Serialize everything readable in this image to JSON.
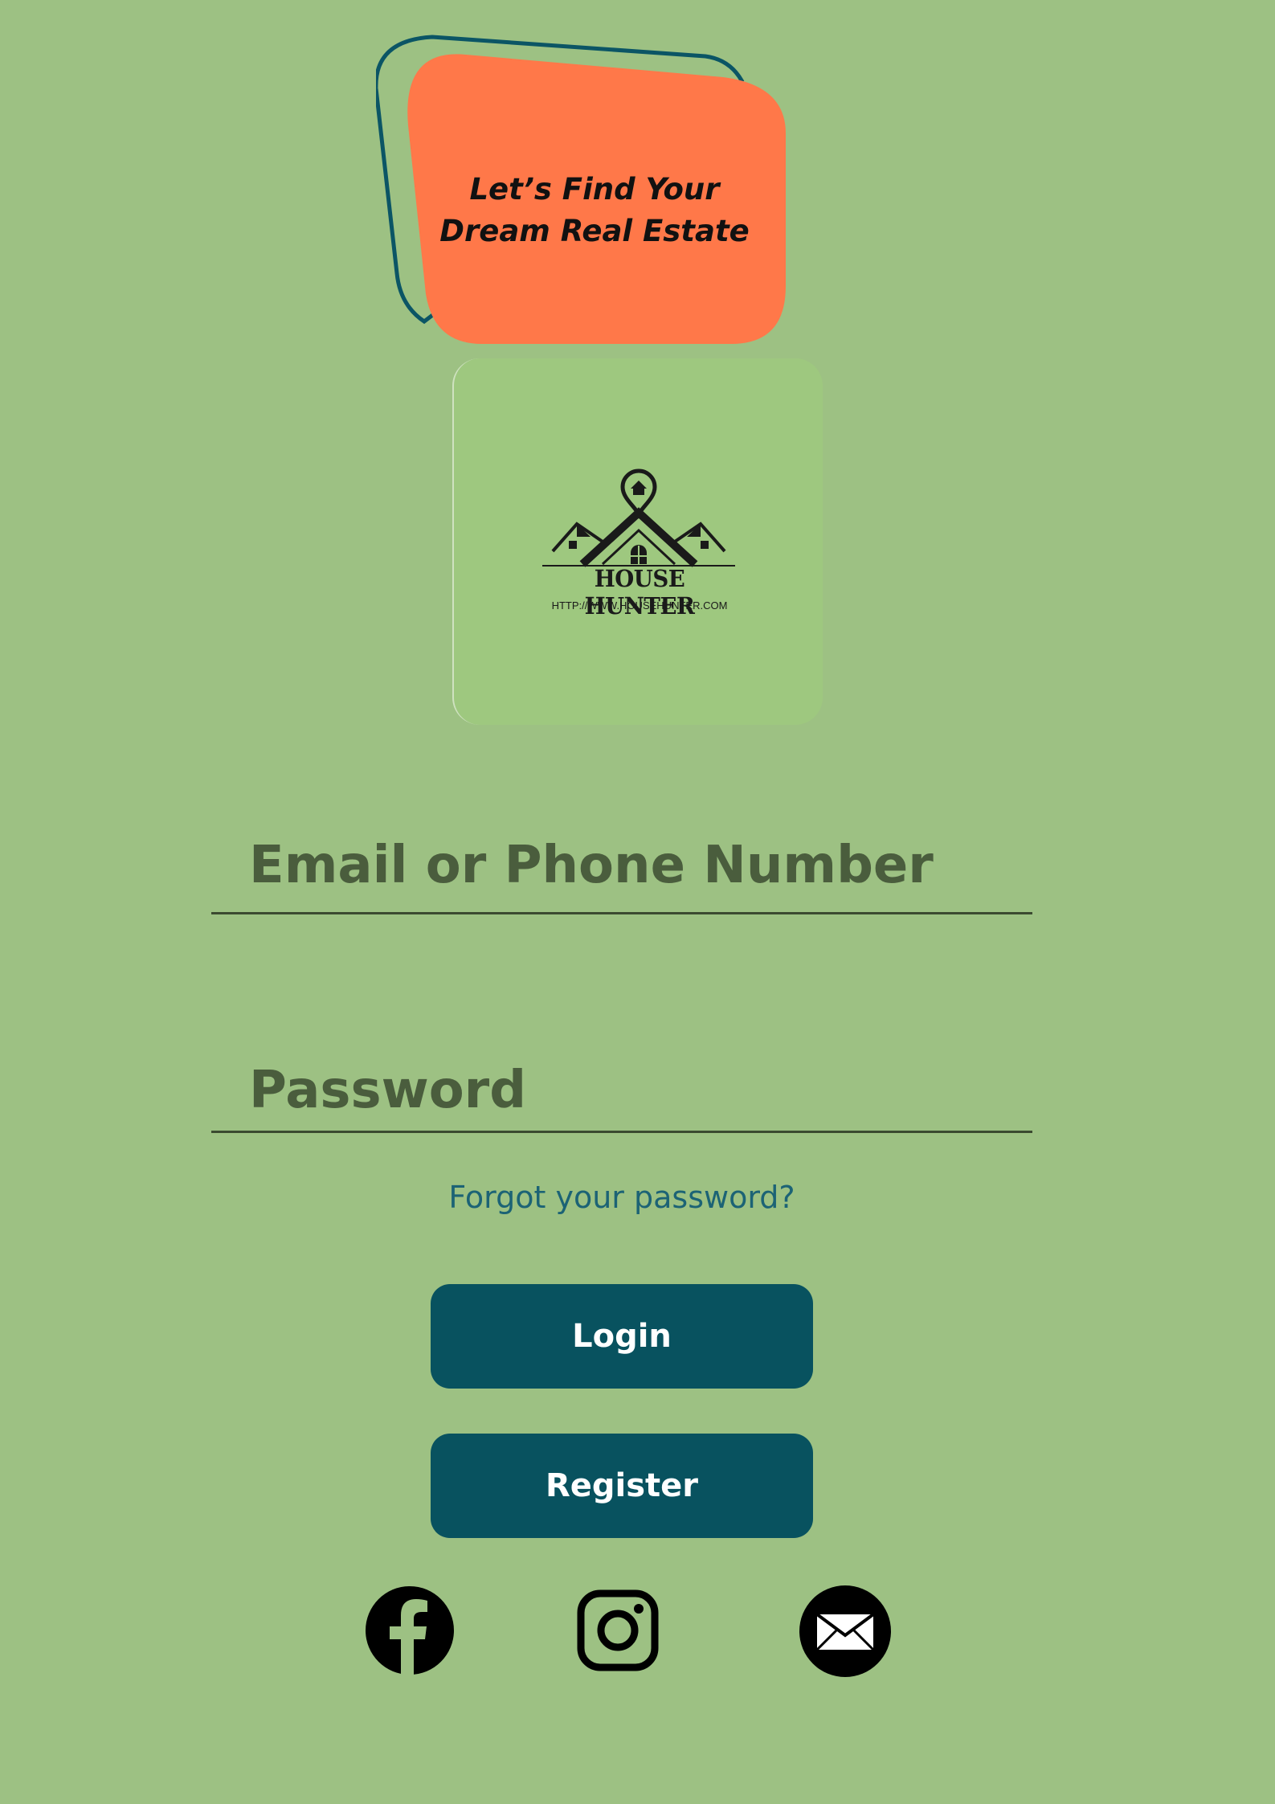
{
  "hero": {
    "tagline_line1": "Let’s Find Your",
    "tagline_line2": "Dream Real Estate"
  },
  "brand": {
    "name": "HOUSE HUNTER",
    "url": "HTTP://WWW.HOUSEHUNTER.COM",
    "logo_icon": "house-location-pin-icon"
  },
  "form": {
    "email_placeholder": "Email or Phone Number",
    "password_placeholder": "Password",
    "forgot_label": "Forgot your password?",
    "login_label": "Login",
    "register_label": "Register"
  },
  "social": [
    {
      "name": "facebook",
      "icon": "facebook-icon"
    },
    {
      "name": "instagram",
      "icon": "instagram-icon"
    },
    {
      "name": "email",
      "icon": "mail-icon"
    }
  ],
  "colors": {
    "background": "#9dc183",
    "accent_orange": "#ff7849",
    "button": "#08525f",
    "outline": "#0b5565",
    "placeholder_text": "#4a5d3d",
    "link": "#1c6375"
  }
}
